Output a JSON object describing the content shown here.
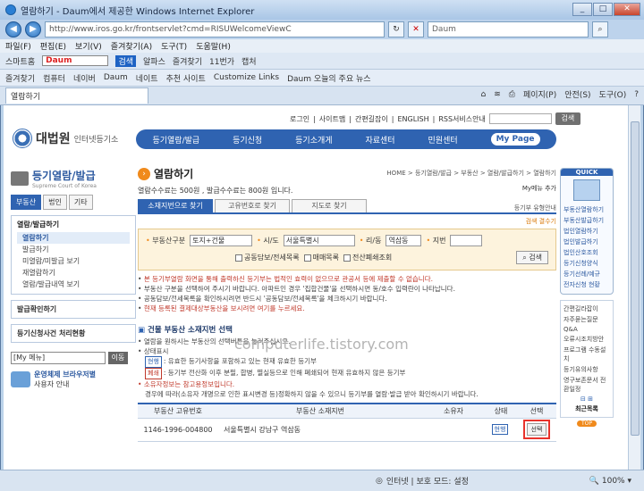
{
  "window": {
    "title": "열람하기 - Daum에서 제공한 Windows Internet Explorer",
    "url": "http://www.iros.go.kr/frontservlet?cmd=RISUWelcomeViewC",
    "search_placeholder": "Daum"
  },
  "menu": [
    "파일(F)",
    "편집(E)",
    "보기(V)",
    "즐겨찾기(A)",
    "도구(T)",
    "도움말(H)"
  ],
  "toolbar": [
    "스마트홈",
    "Daum",
    "검색",
    "알파스",
    "즐겨찾기",
    "11번가",
    "캡처"
  ],
  "favbar": [
    "즐겨찾기",
    "컴퓨터",
    "네이버",
    "Daum",
    "네이트",
    "추천 사이트",
    "Customize Links",
    "Daum 오늘의 주요 뉴스"
  ],
  "tab": {
    "label": "열람하기"
  },
  "tabtools": [
    "페이지(P)",
    "안전(S)",
    "도구(O)"
  ],
  "toplinks": {
    "items": [
      "로그인",
      "사이트맵",
      "간편길잡이",
      "ENGLISH",
      "RSS서비스안내"
    ],
    "search_btn": "검색"
  },
  "logo": {
    "main": "대법원",
    "sub": "인터넷등기소"
  },
  "gnav": [
    "등기열람/발급",
    "등기신청",
    "등기소개게",
    "자료센터",
    "민원센터",
    "My Page"
  ],
  "side": {
    "title": "등기열람/발급",
    "subtitle": "Supreme Court of Korea",
    "tabs": [
      "부동산",
      "법인",
      "기타"
    ],
    "box_title": "열람/발급하기",
    "items": [
      "열람하기",
      "발급하기",
      "미열람/미발급 보기",
      "재열람하기",
      "열람/발급내역 보기"
    ],
    "line1": "발급확인하기",
    "line2": "등기신청사건 처리현황",
    "mymenu": "[My 메뉴]",
    "go": "이동",
    "remote_title": "운영체제 브라우저별",
    "remote_sub": "사용자 안내"
  },
  "main": {
    "title": "열람하기",
    "breadcrumb": "HOME > 등기열람/발급 > 부동산 > 열람/발급하기 > 열람하기",
    "fee": "열람수수료는 500원 , 발급수수료는 800원 입니다.",
    "mytip": "My메뉴 추가",
    "tabs": [
      "소재지번으로 찾기",
      "고유번호로 찾기",
      "지도로 찾기"
    ],
    "tab_right": "등기부 유형안내",
    "find": "검색 결수기",
    "form": {
      "type_label": "부동산구분",
      "type_value": "토지+건물",
      "city_label": "시/도",
      "city_value": "서울특별시",
      "dong_label": "리/동",
      "dong_value": "역삼동",
      "jibun_label": "지번",
      "jibun_value": "",
      "check1": "공동담보/전세목록",
      "check2": "매매목록",
      "check3": "전산폐쇄조회",
      "search": "검색"
    },
    "notes": [
      "본 등기부열람 화면을 통해 출력하신 등기부는 법적인 효력이 없으므로 관공서 등에 제출할 수 없습니다.",
      "부동산 구분을 선택하여 주시기 바랍니다. 아파트인 경우 '집합건물'을 선택하시면 동/호수 입력란이 나타납니다.",
      "공동담보/전세목록을 확인하시려면 반드시 '공동담보/전세목록'을 체크하시기 바랍니다.",
      "현재 등록된 결제대상부동산을 보시려면 여기를 누르세요."
    ],
    "section": "건물 부동산 소재지번 선택",
    "section_body": [
      "열람을 원하시는 부동산의 선택버튼을 눌러주십시오.",
      "상태표시",
      ": 유효한 등기사항을 포함하고 있는 현재 유효한 등기부",
      ": 등기부 전산화 이후 분필, 합병, 멸실등으로 인해 폐쇄되어 현재 유효하지 않은 등기부",
      "소유자정보는 참고용정보입니다.",
      "경우에 따라(소유자 개명으로 인한 표시변경 등)정확하지 않을 수 있으니 등기부를 열람·발급 받아 확인하시기 바랍니다."
    ],
    "tag_valid": "현행",
    "tag_closed": "폐쇄",
    "table": {
      "headers": [
        "부동산 고유번호",
        "부동산 소재지번",
        "소유자",
        "상태",
        "선택"
      ],
      "rows": [
        {
          "id": "1146-1996-004800",
          "addr": "서울특별시 강남구 역삼동",
          "owner": "",
          "status": "현행",
          "select": "선택"
        }
      ]
    }
  },
  "right": {
    "quick": "QUICK",
    "links": [
      "부동산열람하기",
      "부동산발급하기",
      "법인열람하기",
      "법인발급하기",
      "법인산호조회",
      "등기신청양식",
      "등기선례/예규",
      "전자신청 현황"
    ],
    "list": [
      "간편길라잡이",
      "자주묻는질문",
      "Q&A",
      "오류시조치방안",
      "프로그램 수동설치",
      "등기유의사항",
      "영구보존문서 전환일정"
    ],
    "recent": "최근목록",
    "top": "TOP"
  },
  "watermark": "computerlife.tistory.com",
  "status": {
    "zone": "인터넷 | 보호 모드: 설정",
    "zoom": "100%"
  }
}
